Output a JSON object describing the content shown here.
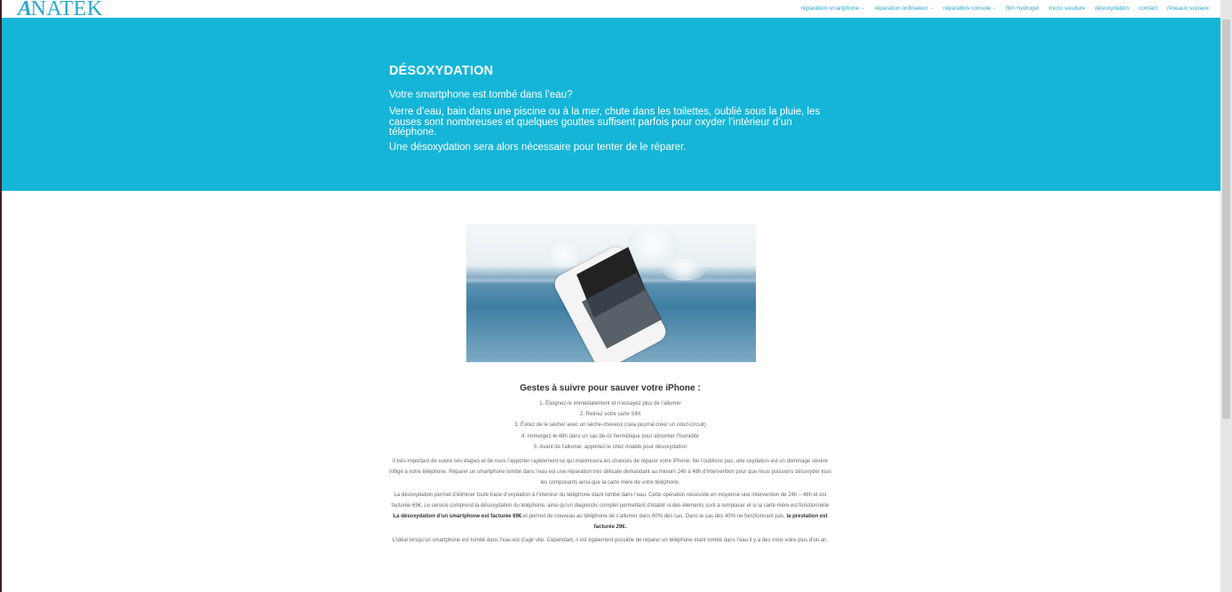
{
  "brand": {
    "name": "NATEK",
    "mark": "A",
    "accent_color": "#15b5d8",
    "link_color": "#2aa7cc"
  },
  "nav": {
    "items": [
      {
        "label": "réparation smartphone",
        "has_dropdown": true
      },
      {
        "label": "réparation ordinateur",
        "has_dropdown": true
      },
      {
        "label": "réparation console",
        "has_dropdown": true
      },
      {
        "label": "film hydrogel",
        "has_dropdown": false
      },
      {
        "label": "micro soudure",
        "has_dropdown": false
      },
      {
        "label": "désoxydation",
        "has_dropdown": false
      },
      {
        "label": "contact",
        "has_dropdown": false
      },
      {
        "label": "réseaux sociaux",
        "has_dropdown": false
      }
    ],
    "chevron": "⌄"
  },
  "hero": {
    "title": "DÉSOXYDATION",
    "line1": "Votre smartphone est tombé dans l’eau?",
    "line2": "Verre d’eau, bain dans une piscine ou à la mer, chute dans les toilettes, oublié sous la pluie, les causes sont nombreuses et quelques gouttes suffisent parfois pour oxyder l’intérieur d’un téléphone.",
    "line3": "Une désoxydation sera alors nécessaire pour tenter de le réparer."
  },
  "image": {
    "icon": "phone-in-water-photo"
  },
  "content": {
    "section_title": "Gestes à suivre pour sauver votre iPhone :",
    "steps": [
      "1. Éteignez-le immédiatement et n’essayez plus de l’allumer",
      "2. Retirez votre carte SIM",
      "3. Évitez de le sécher avec un sèche-cheveux (cela pourrai créer un court-circuit)",
      "4. Immergez-le 48h dans un sac de riz hermétique pour absorber l’humidité",
      "5. Avant de l’allumer, apportez-le chez Anatek pour désoxydation"
    ],
    "p1": "Il très important de suivre ces étapes et de nous l’apporter rapidement ce qui maximisera les chances de réparer votre iPhone. Ne l’oublions pas, une oxydation est un dommage sévère infligé à votre téléphone. Réparer un smartphone tombé dans l’eau est une réparation très délicate demandant au minium 24h à 48h d’intervention pour que nous puissions désoxyder tous les composants ainsi que la carte mère de votre téléphone.",
    "p2_a": "La désoxydation permet d’éliminer toute trace d’oxydation à l’intérieur du téléphone étant tombé dans l’eau. Cette opération nécessite en moyenne une intervention de 24h – 48h et est facturée  69€. Le service comprend la désoxydation du téléphone, ainsi qu’un diagnostic complet permettant d’établir si des éléments sont à remplacer et si la carte mère est fonctionnelle ",
    "p2_b": "La désoxydation d’un smartphone est facturée 69€",
    "p2_c": " et permet de nouveau au téléphone de s’allumer dans 60% des cas. Dans le cas des 40% ne fonctionnant pas, ",
    "p2_d": "la prestation est facturée 29€.",
    "p3": "L’idéal lorsqu’un smartphone est tombé dans l’eau est d’agir vite. Cependant, il est également possible de réparer un téléphone étant tombé dans l’eau il y a des mois voire plus d’un an."
  }
}
